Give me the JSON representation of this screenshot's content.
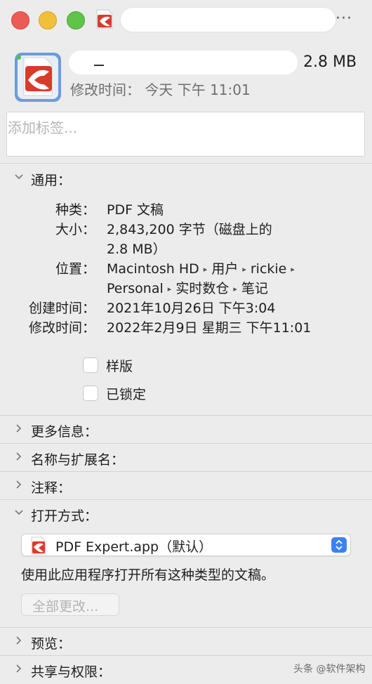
{
  "window": {
    "title_redacted": true
  },
  "header": {
    "file_size": "2.8 MB",
    "modified_label": "修改时间：",
    "modified_value": "今天 下午 11:01"
  },
  "tags": {
    "placeholder": "添加标签..."
  },
  "general": {
    "title": "通用：",
    "rows": [
      {
        "label": "种类：",
        "value": "PDF 文稿"
      },
      {
        "label": "大小：",
        "value": "2,843,200 字节（磁盘上的",
        "value2": "2.8 MB）"
      },
      {
        "label": "位置：",
        "path1": [
          "Macintosh HD",
          "用户",
          "rickie"
        ],
        "path2": [
          "Personal",
          "实时数仓",
          "笔记"
        ]
      },
      {
        "label": "创建时间：",
        "value": "2021年10月26日 下午3:04"
      },
      {
        "label": "修改时间：",
        "value": "2022年2月9日 星期三 下午11:01"
      }
    ],
    "stationery_label": "样版",
    "locked_label": "已锁定"
  },
  "sections": {
    "more_info": "更多信息：",
    "name_ext": "名称与扩展名：",
    "comments": "注释：",
    "open_with": "打开方式：",
    "preview": "预览：",
    "sharing": "共享与权限："
  },
  "open_with": {
    "app_name": "PDF Expert.app（默认）",
    "description": "使用此应用程序打开所有这种类型的文稿。",
    "change_all_label": "全部更改..."
  },
  "watermark": "头条 @软件架构",
  "colors": {
    "background": "#ececec",
    "app_icon_red": "#d93a2b",
    "stepper_blue": "#3b82f6"
  },
  "icons": [
    "pdf-expert-icon",
    "chevron-down-icon",
    "chevron-right-icon",
    "ellipsis-icon",
    "popup-stepper-icon"
  ]
}
